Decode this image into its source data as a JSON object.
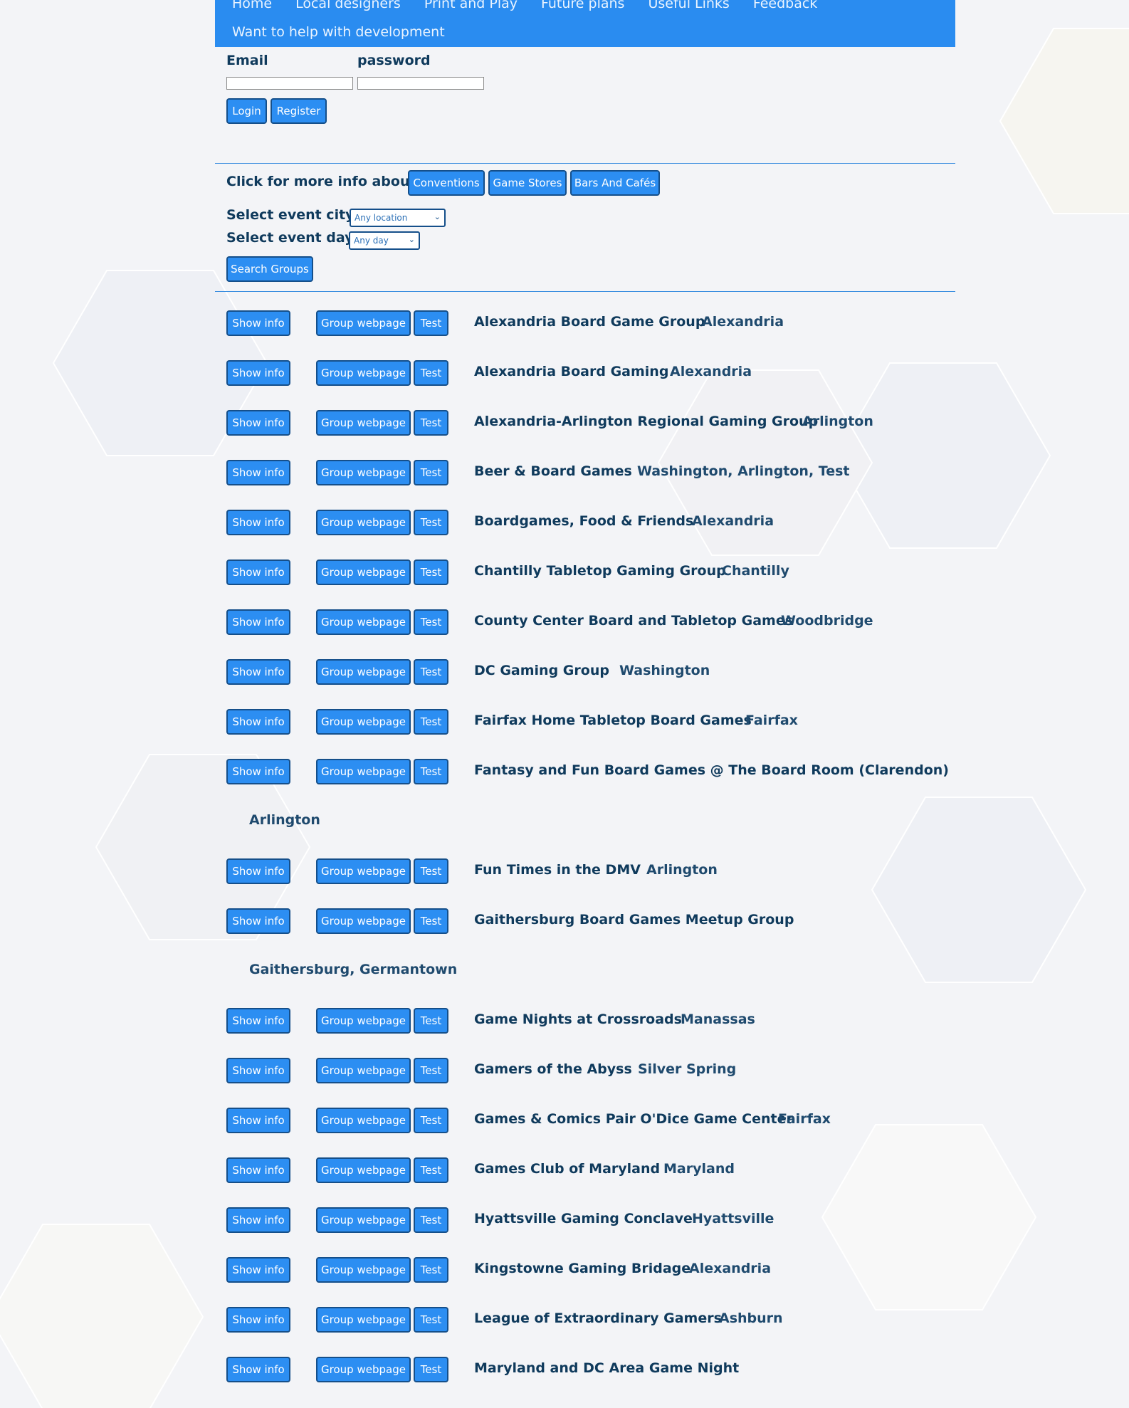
{
  "nav": {
    "items": [
      "Home",
      "Local designers",
      "Print and Play",
      "Future plans",
      "Useful Links",
      "Feedback"
    ],
    "help": "Want to help with development"
  },
  "login": {
    "email_label": "Email",
    "password_label": "password",
    "login_button": "Login",
    "register_button": "Register"
  },
  "info": {
    "label": "Click for more info about",
    "buttons": [
      "Conventions",
      "Game Stores",
      "Bars And Cafés"
    ]
  },
  "filters": {
    "city_label": "Select event city:",
    "city_value": "Any location",
    "day_label": "Select event day:",
    "day_value": "Any day",
    "search_button": "Search Groups"
  },
  "row_buttons": {
    "show_info": "Show info",
    "group_webpage": "Group webpage",
    "test": "Test"
  },
  "groups": [
    {
      "name": "Alexandria Board Game Group",
      "city": "Alexandria"
    },
    {
      "name": "Alexandria Board Gaming",
      "city": "Alexandria"
    },
    {
      "name": "Alexandria-Arlington Regional Gaming Group",
      "city": "Arlington"
    },
    {
      "name": "Beer & Board Games",
      "city": "Washington, Arlington, Test"
    },
    {
      "name": "Boardgames, Food & Friends",
      "city": "Alexandria"
    },
    {
      "name": "Chantilly Tabletop Gaming Group",
      "city": "Chantilly"
    },
    {
      "name": "County Center Board and Tabletop Games",
      "city": "Woodbridge"
    },
    {
      "name": "DC Gaming Group",
      "city": "Washington"
    },
    {
      "name": "Fairfax Home Tabletop Board Games",
      "city": "Fairfax"
    },
    {
      "name": "Fantasy and Fun Board Games @ The Board Room (Clarendon)",
      "city": "Arlington"
    },
    {
      "name": "Fun Times in the DMV",
      "city": "Arlington"
    },
    {
      "name": "Gaithersburg Board Games Meetup Group",
      "city": "Gaithersburg, Germantown"
    },
    {
      "name": "Game Nights at Crossroads",
      "city": "Manassas"
    },
    {
      "name": "Gamers of the Abyss",
      "city": "Silver Spring"
    },
    {
      "name": "Games & Comics Pair O'Dice Game Center",
      "city": "Fairfax"
    },
    {
      "name": "Games Club of Maryland",
      "city": "Maryland"
    },
    {
      "name": "Hyattsville Gaming Conclave",
      "city": "Hyattsville"
    },
    {
      "name": "Kingstowne Gaming Bridage",
      "city": "Alexandria"
    },
    {
      "name": "League of Extraordinary Gamers",
      "city": "Ashburn"
    },
    {
      "name": "Maryland and DC Area Game Night",
      "city": ""
    }
  ]
}
